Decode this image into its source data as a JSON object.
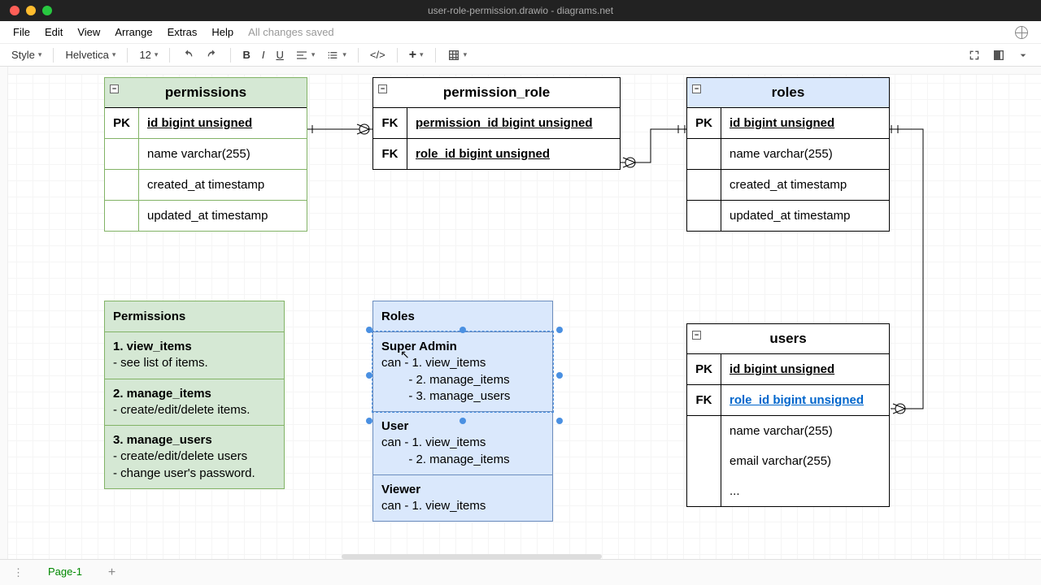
{
  "window": {
    "title": "user-role-permission.drawio - diagrams.net"
  },
  "menubar": {
    "items": [
      "File",
      "Edit",
      "View",
      "Arrange",
      "Extras",
      "Help"
    ],
    "status": "All changes saved"
  },
  "toolbar": {
    "style": "Style",
    "font": "Helvetica",
    "fontsize": "12"
  },
  "entities": {
    "permissions": {
      "title": "permissions",
      "rows": [
        {
          "key": "PK",
          "field": "id bigint unsigned",
          "pk": true
        },
        {
          "key": "",
          "field": "name varchar(255)"
        },
        {
          "key": "",
          "field": "created_at timestamp"
        },
        {
          "key": "",
          "field": "updated_at timestamp"
        }
      ]
    },
    "permission_role": {
      "title": "permission_role",
      "rows": [
        {
          "key": "FK",
          "field": "permission_id bigint unsigned",
          "pk": true
        },
        {
          "key": "FK",
          "field": "role_id bigint unsigned",
          "pk": true
        }
      ]
    },
    "roles": {
      "title": "roles",
      "rows": [
        {
          "key": "PK",
          "field": "id bigint unsigned",
          "pk": true
        },
        {
          "key": "",
          "field": "name varchar(255)"
        },
        {
          "key": "",
          "field": "created_at timestamp"
        },
        {
          "key": "",
          "field": "updated_at timestamp"
        }
      ]
    },
    "users": {
      "title": "users",
      "rows": [
        {
          "key": "PK",
          "field": "id bigint unsigned",
          "pk": true
        },
        {
          "key": "FK",
          "field": "role_id bigint unsigned",
          "fk": true
        },
        {
          "key": "",
          "field": "name varchar(255)"
        },
        {
          "key": "",
          "field": "email varchar(255)"
        },
        {
          "key": "",
          "field": "..."
        }
      ]
    }
  },
  "notes": {
    "permissions": {
      "title": "Permissions",
      "items": [
        {
          "h": "1. view_items",
          "body": "- see list of items."
        },
        {
          "h": "2. manage_items",
          "body": "- create/edit/delete items."
        },
        {
          "h": "3. manage_users",
          "body": "- create/edit/delete users\n- change user's password."
        }
      ]
    },
    "roles": {
      "title": "Roles",
      "items": [
        {
          "h": "Super Admin",
          "body": "can - 1. view_items\n        - 2. manage_items\n        - 3. manage_users"
        },
        {
          "h": "User",
          "body": "can - 1. view_items\n        - 2. manage_items"
        },
        {
          "h": "Viewer",
          "body": "can - 1. view_items"
        }
      ]
    }
  },
  "tabs": {
    "page": "Page-1"
  }
}
